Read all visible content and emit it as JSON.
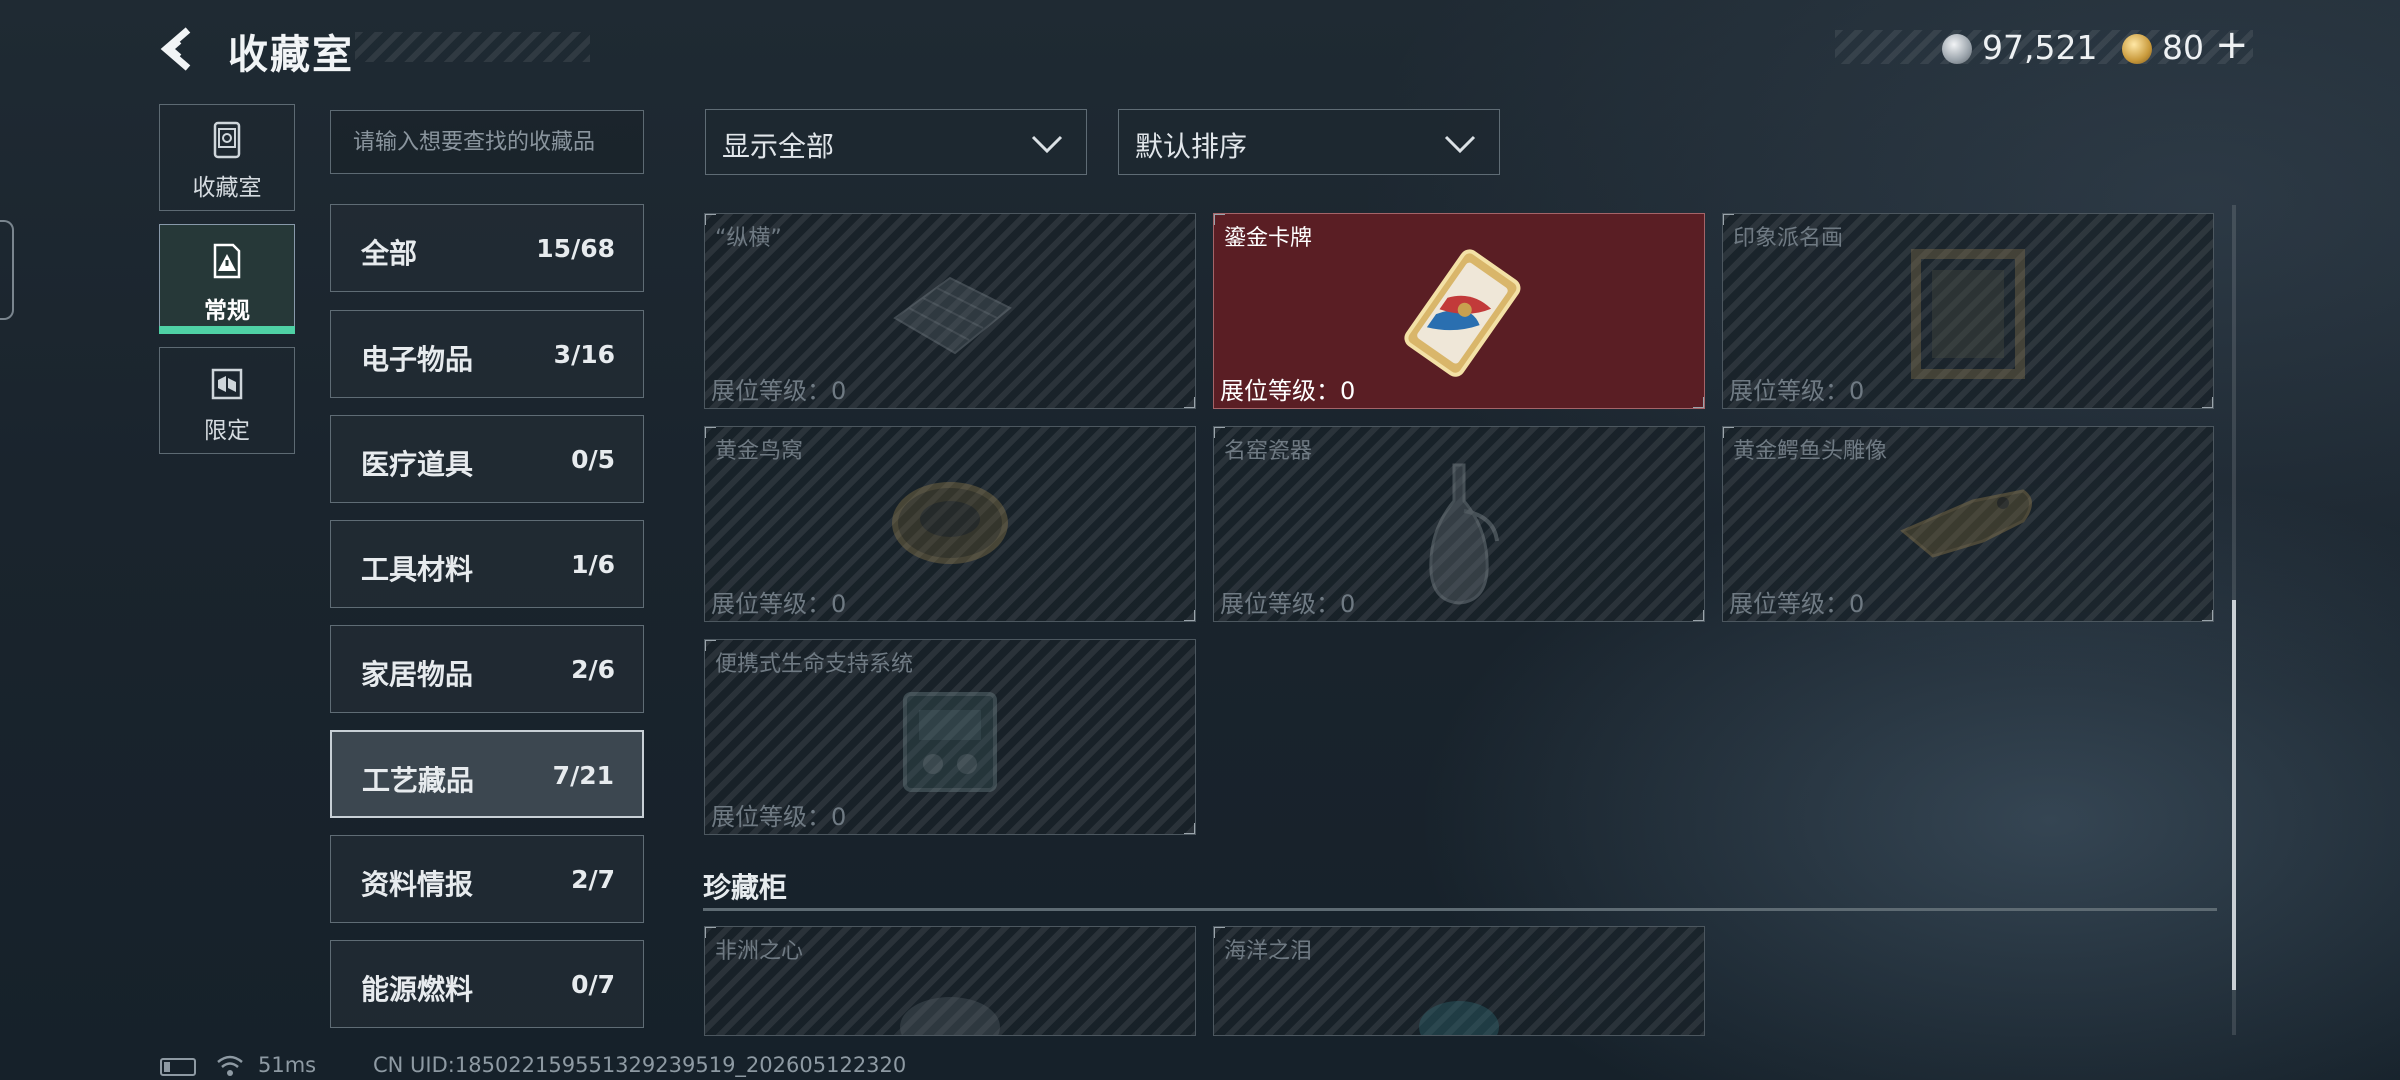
{
  "header": {
    "title": "收藏室"
  },
  "currency": {
    "silver": "97,521",
    "gold": "80",
    "plus": "+"
  },
  "left_tabs": [
    {
      "label": "收藏室"
    },
    {
      "label": "常规"
    },
    {
      "label": "限定"
    }
  ],
  "search": {
    "placeholder": "请输入想要查找的收藏品",
    "value": ""
  },
  "categories": [
    {
      "name": "全部",
      "count": "15/68"
    },
    {
      "name": "电子物品",
      "count": "3/16"
    },
    {
      "name": "医疗道具",
      "count": "0/5"
    },
    {
      "name": "工具材料",
      "count": "1/6"
    },
    {
      "name": "家居物品",
      "count": "2/6"
    },
    {
      "name": "工艺藏品",
      "count": "7/21"
    },
    {
      "name": "资料情报",
      "count": "2/7"
    },
    {
      "name": "能源燃料",
      "count": "0/7"
    }
  ],
  "active_category": "工艺藏品",
  "filter": {
    "selected": "显示全部"
  },
  "sort": {
    "selected": "默认排序"
  },
  "items": [
    {
      "name": "“纵横”",
      "level": "展位等级：0",
      "owned": false
    },
    {
      "name": "鎏金卡牌",
      "level": "展位等级：0",
      "owned": true
    },
    {
      "name": "印象派名画",
      "level": "展位等级：0",
      "owned": false
    },
    {
      "name": "黄金鸟窝",
      "level": "展位等级：0",
      "owned": false
    },
    {
      "name": "名窑瓷器",
      "level": "展位等级：0",
      "owned": false
    },
    {
      "name": "黄金鳄鱼头雕像",
      "level": "展位等级：0",
      "owned": false
    },
    {
      "name": "便携式生命支持系统",
      "level": "展位等级：0",
      "owned": false
    }
  ],
  "section2": {
    "title": "珍藏柜",
    "items": [
      {
        "name": "非洲之心"
      },
      {
        "name": "海洋之泪"
      }
    ]
  },
  "status": {
    "ping": "51ms",
    "uid": "CN UID:185022159551329239519_202605122320"
  },
  "colors": {
    "accent": "#4fd1a5",
    "owned_card": "#5a1e24"
  }
}
